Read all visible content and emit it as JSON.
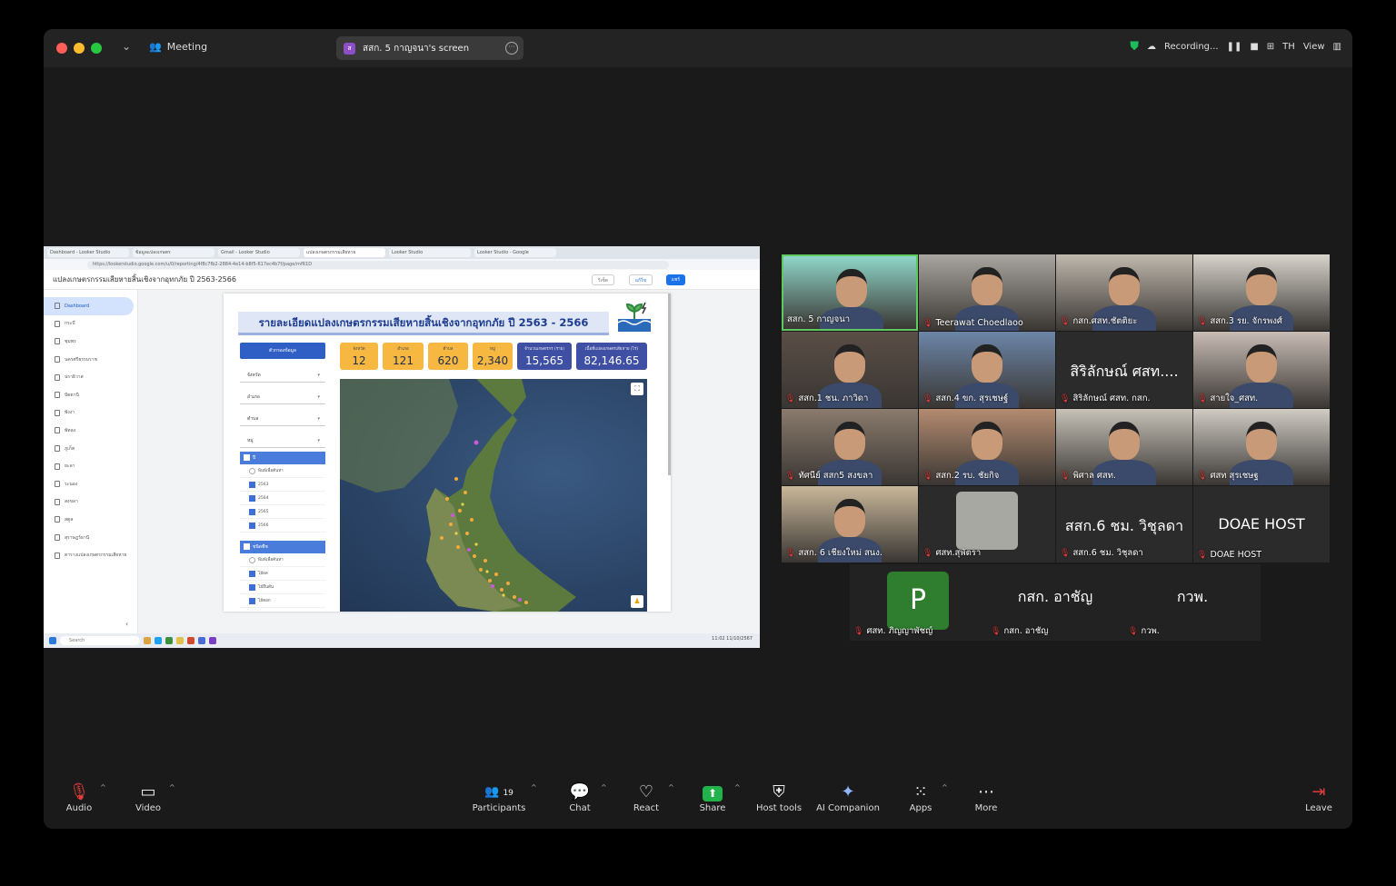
{
  "titlebar": {
    "meeting_label": "Meeting",
    "share_pill_label": "สสก. 5 กาญจนา's screen",
    "share_pill_badge": "ส",
    "recording_label": "Recording...",
    "lang": "TH",
    "view_label": "View"
  },
  "shared_screen": {
    "browser_tabs": [
      "Dashboard - Looker Studio",
      "ข้อมูลแปลงเกษตร",
      "Gmail - Looker Studio",
      "แปลงเกษตรกรรมเสียหาย",
      "Looker Studio",
      "Looker Studio - Google"
    ],
    "url": "https://lookerstudio.google.com/u/0/reporting/4f8c7fb2-2884-4e14-b8f5-617ec4b7f/page/mfR1D",
    "report_header_title": "แปลงเกษตรกรรมเสียหายสิ้นเชิงจากอุทกภัย ปี 2563-2566",
    "btn_reset": "รีเซ็ต",
    "btn_edit": "แก้ไข",
    "btn_share": "แชร์",
    "nav": [
      "Dashboard",
      "กระบี่",
      "ชุมพร",
      "นครศรีธรรมราช",
      "นราธิวาส",
      "ปัตตานี",
      "พังงา",
      "พัทลุง",
      "ภูเก็ต",
      "ยะลา",
      "ระนอง",
      "สงขลา",
      "สตูล",
      "สุราษฎร์ธานี",
      "ตารางแปลงเกษตรกรรมเสียหาย"
    ],
    "report_title": "รายละเอียดแปลงเกษตรกรรมเสียหายสิ้นเชิงจากอุทกภัย ปี 2563 - 2566",
    "filter_header": "ตัวกรองข้อมูล",
    "filters": [
      "จังหวัด",
      "อำเภอ",
      "ตำบล",
      "หมู่"
    ],
    "year_group": {
      "head": "ปี",
      "search": "พิมพ์เพื่อค้นหา",
      "items": [
        "2563",
        "2564",
        "2565",
        "2566"
      ]
    },
    "crop_group": {
      "head": "ชนิดพืช",
      "search": "พิมพ์เพื่อค้นหา",
      "items": [
        "ไม้ผล",
        "ไม้ยืนต้น",
        "ไม้ดอก"
      ]
    },
    "kpis": [
      {
        "label": "จังหวัด",
        "value": "12",
        "style": "orange"
      },
      {
        "label": "อำเภอ",
        "value": "121",
        "style": "orange"
      },
      {
        "label": "ตำบล",
        "value": "620",
        "style": "orange"
      },
      {
        "label": "หมู่",
        "value": "2,340",
        "style": "orange"
      },
      {
        "label": "จำนวนเกษตรกร (ราย)",
        "value": "15,565",
        "style": "navy"
      },
      {
        "label": "เนื้อที่แปลงเกษตรเสียหาย (ไร่)",
        "value": "82,146.65",
        "style": "navy"
      }
    ],
    "taskbar_search": "Search",
    "taskbar_clock": "11:02 11/10/2567"
  },
  "gallery": {
    "tiles": [
      {
        "name": "สสก. 5 กาญจนา",
        "muted": false,
        "kind": "video",
        "bg": "#8fd6c8"
      },
      {
        "name": "Teerawat Choedlaoo",
        "muted": true,
        "kind": "video",
        "bg": "#a9a6a0"
      },
      {
        "name": "กสก.ศสท.ชัตติยะ",
        "muted": true,
        "kind": "video",
        "bg": "#bfb8ad"
      },
      {
        "name": "สสก.3 รย. จักรพงศ์",
        "muted": true,
        "kind": "video",
        "bg": "#d8d4cc"
      },
      {
        "name": "สสก.1 ชน. ภาวิดา",
        "muted": true,
        "kind": "video",
        "bg": "#5a4e46"
      },
      {
        "name": "สสก.4 ขก. สุรเชษฐ์",
        "muted": true,
        "kind": "video",
        "bg": "#6c86a8"
      },
      {
        "name": "สิริลักษณ์ ศสท. กสก.",
        "muted": true,
        "kind": "name",
        "big": "สิริลักษณ์ ศสท...."
      },
      {
        "name": "สายใจ_ศสท.",
        "muted": true,
        "kind": "video",
        "bg": "#c8bdb5"
      },
      {
        "name": "ทัศนีย์ สสก5 สงขลา",
        "muted": true,
        "kind": "video",
        "bg": "#8a7b6d"
      },
      {
        "name": "สสก.2 รบ. ชัยกิจ",
        "muted": true,
        "kind": "video",
        "bg": "#b38b70"
      },
      {
        "name": "พิศาล ศสท.",
        "muted": true,
        "kind": "video",
        "bg": "#c6c2b8"
      },
      {
        "name": "ศสท สุรเชษฐ",
        "muted": true,
        "kind": "video",
        "bg": "#d0ccc4"
      },
      {
        "name": "สสก. 6 เชียงใหม่ สนง.",
        "muted": true,
        "kind": "video",
        "bg": "#c9b79a"
      },
      {
        "name": "ศสท.สุพัตรา",
        "muted": true,
        "kind": "photo",
        "bg": "#2b2b2b"
      },
      {
        "name": "สสก.6 ชม. วิชุลดา",
        "muted": true,
        "kind": "name",
        "big": "สสก.6 ชม. วิชุลดา"
      },
      {
        "name": "DOAE HOST",
        "muted": true,
        "kind": "name",
        "big": "DOAE HOST"
      }
    ],
    "bottom": [
      {
        "name": "ศสท. ภิญญาพัชญ์",
        "avatar": "P"
      },
      {
        "name": "กสก. อาชัญ",
        "big": "กสก. อาชัญ"
      },
      {
        "name": "กวพ.",
        "big": "กวพ."
      }
    ]
  },
  "toolbar": {
    "audio": "Audio",
    "video": "Video",
    "participants": "Participants",
    "participants_count": "19",
    "chat": "Chat",
    "react": "React",
    "share": "Share",
    "host_tools": "Host tools",
    "ai_companion": "AI Companion",
    "apps": "Apps",
    "more": "More",
    "leave": "Leave"
  }
}
